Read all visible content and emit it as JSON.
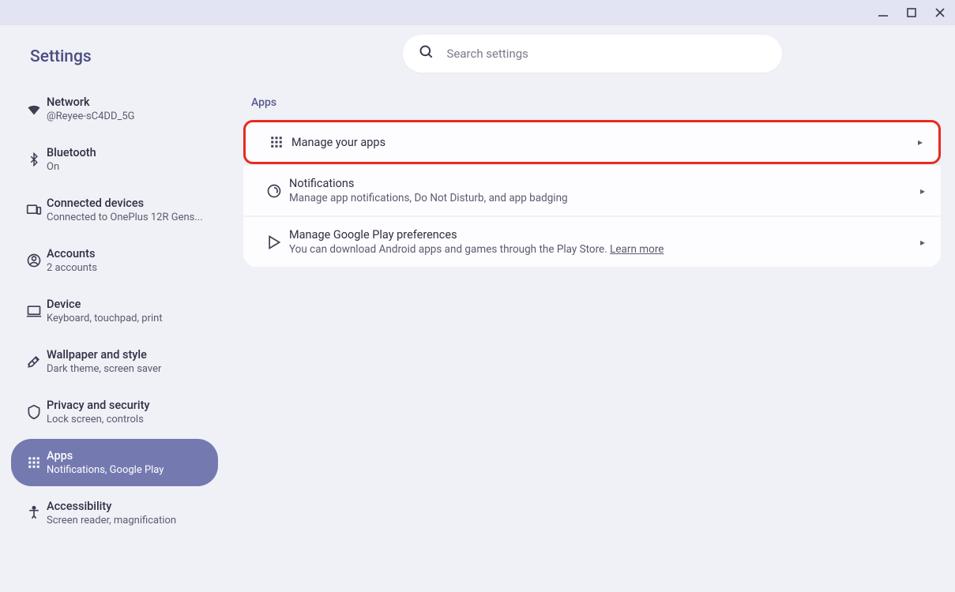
{
  "app_title": "Settings",
  "search": {
    "placeholder": "Search settings"
  },
  "sidebar": {
    "items": [
      {
        "title": "Network",
        "subtitle": "@Reyee-sC4DD_5G"
      },
      {
        "title": "Bluetooth",
        "subtitle": "On"
      },
      {
        "title": "Connected devices",
        "subtitle": "Connected to OnePlus 12R Gens..."
      },
      {
        "title": "Accounts",
        "subtitle": "2 accounts"
      },
      {
        "title": "Device",
        "subtitle": "Keyboard, touchpad, print"
      },
      {
        "title": "Wallpaper and style",
        "subtitle": "Dark theme, screen saver"
      },
      {
        "title": "Privacy and security",
        "subtitle": "Lock screen, controls"
      },
      {
        "title": "Apps",
        "subtitle": "Notifications, Google Play"
      },
      {
        "title": "Accessibility",
        "subtitle": "Screen reader, magnification"
      }
    ]
  },
  "main": {
    "section_title": "Apps",
    "rows": [
      {
        "title": "Manage your apps",
        "subtitle": ""
      },
      {
        "title": "Notifications",
        "subtitle": "Manage app notifications, Do Not Disturb, and app badging"
      },
      {
        "title": "Manage Google Play preferences",
        "subtitle_prefix": "You can download Android apps and games through the Play Store. ",
        "learn_more": "Learn more"
      }
    ]
  }
}
